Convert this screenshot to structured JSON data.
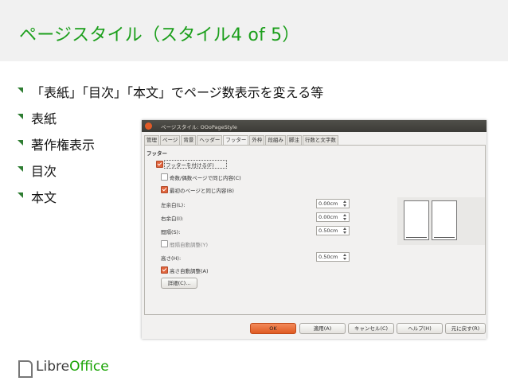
{
  "slide": {
    "title": "ページスタイル（スタイル4 of 5）",
    "bullets": [
      "「表紙」「目次」「本文」でページ数表示を変える等",
      "表紙",
      "著作権表示",
      "目次",
      "本文"
    ],
    "logo": {
      "libre": "Libre",
      "office": "Office"
    }
  },
  "colors": {
    "title": "#1c9f1c",
    "bullet_arrow": "#2e7d32",
    "ok_button": "#e05a22"
  },
  "dialog": {
    "title": "ページスタイル: OOoPageStyle",
    "tabs": [
      "管理",
      "ページ",
      "背景",
      "ヘッダー",
      "フッター",
      "外枠",
      "段組み",
      "脚注",
      "行数と文字数"
    ],
    "active_tab": "フッター",
    "section": "フッター",
    "footer_on": {
      "label": "フッターを付ける(F)",
      "checked": true
    },
    "same_left_right": {
      "label": "奇数/偶数ページで同じ内容(C)",
      "checked": false
    },
    "same_first": {
      "label": "最初のページと同じ内容(B)",
      "checked": true
    },
    "left_margin": {
      "label": "左余白(L):",
      "value": "0.00cm"
    },
    "right_margin": {
      "label": "右余白(I):",
      "value": "0.00cm"
    },
    "spacing": {
      "label": "間隔(S):",
      "value": "0.50cm"
    },
    "dynamic_spacing": {
      "label": "間隔自動調整(Y)",
      "checked": false
    },
    "height": {
      "label": "高さ(H):",
      "value": "0.50cm"
    },
    "autofit": {
      "label": "高さ自動調整(A)",
      "checked": true
    },
    "more_button": "詳細(C)...",
    "buttons": {
      "ok": "OK",
      "apply": "適用(A)",
      "cancel": "キャンセル(C)",
      "help": "ヘルプ(H)",
      "reset": "元に戻す(R)"
    }
  }
}
